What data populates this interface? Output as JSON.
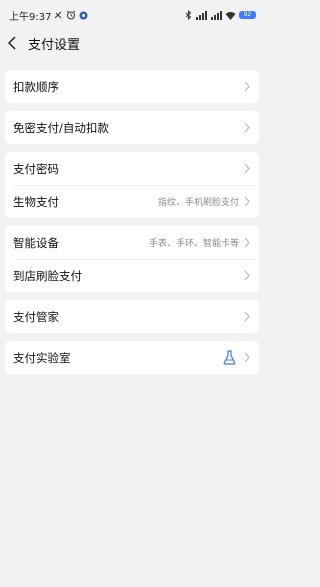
{
  "status_bar": {
    "time": "上午9:37",
    "battery": "92"
  },
  "header": {
    "title": "支付设置"
  },
  "groups": [
    {
      "rows": [
        {
          "label": "扣款顺序"
        }
      ]
    },
    {
      "rows": [
        {
          "label": "免密支付/自动扣款"
        }
      ]
    },
    {
      "rows": [
        {
          "label": "支付密码"
        },
        {
          "label": "生物支付",
          "value": "指纹、手机刷脸支付"
        }
      ]
    },
    {
      "rows": [
        {
          "label": "智能设备",
          "value": "手表、手环、智能卡等"
        },
        {
          "label": "到店刷脸支付"
        }
      ]
    },
    {
      "rows": [
        {
          "label": "支付管家"
        }
      ]
    },
    {
      "rows": [
        {
          "label": "支付实验室",
          "icon": "flask-icon"
        }
      ]
    }
  ],
  "colors": {
    "flask": "#3b7ce0",
    "background": "#f2f2f2",
    "card": "#ffffff"
  }
}
